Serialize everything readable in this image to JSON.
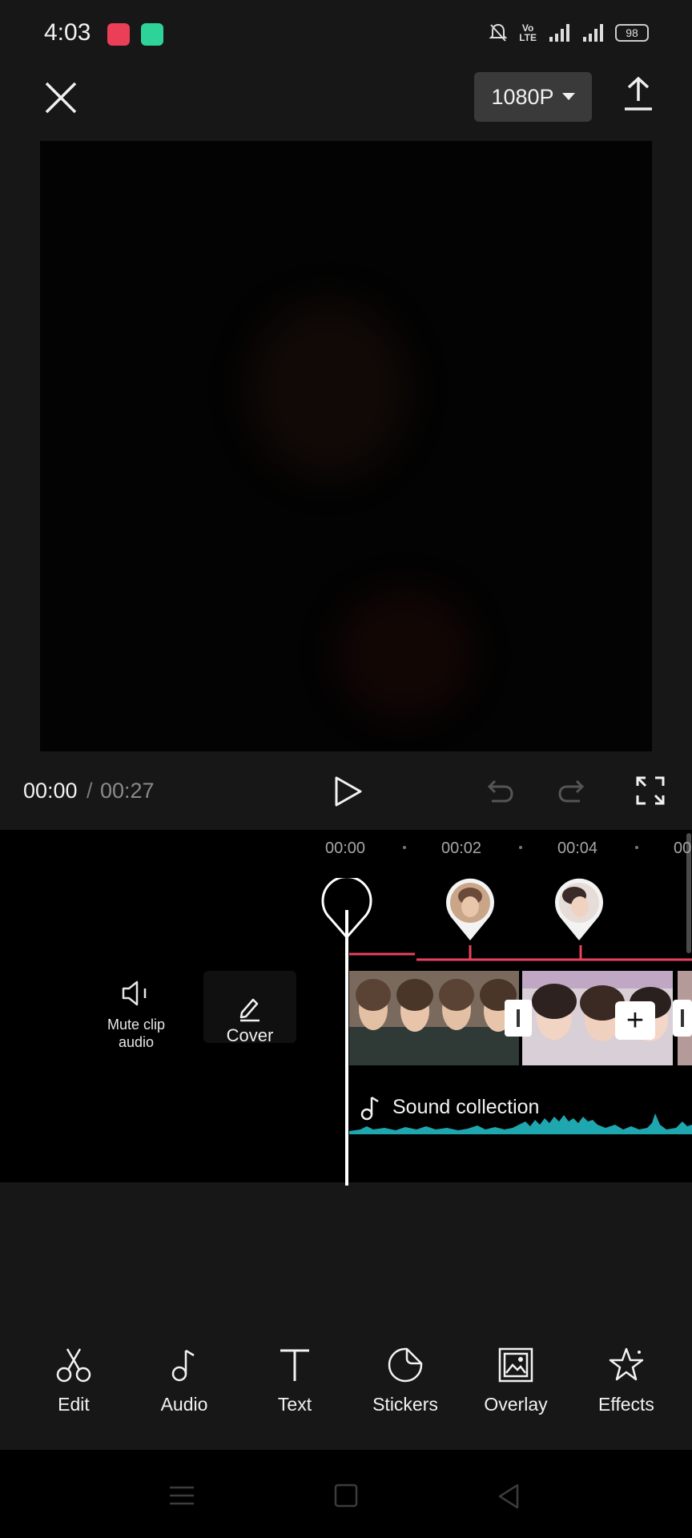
{
  "status_bar": {
    "time": "4:03",
    "volte_top": "Vo",
    "volte_bottom": "LTE",
    "battery": "98"
  },
  "top_bar": {
    "resolution": "1080P"
  },
  "playback": {
    "current_time": "00:00",
    "separator": "/",
    "total_time": "00:27"
  },
  "timeline": {
    "ruler_labels": [
      "00:00",
      "00:02",
      "00:04",
      "00"
    ],
    "mute_label": "Mute clip audio",
    "cover_label": "Cover",
    "audio_track_label": "Sound collection"
  },
  "toolbar": {
    "items": [
      {
        "label": "Edit",
        "icon": "scissors-icon"
      },
      {
        "label": "Audio",
        "icon": "music-note-icon"
      },
      {
        "label": "Text",
        "icon": "text-icon"
      },
      {
        "label": "Stickers",
        "icon": "sticker-icon"
      },
      {
        "label": "Overlay",
        "icon": "overlay-icon"
      },
      {
        "label": "Effects",
        "icon": "effects-star-icon"
      }
    ]
  },
  "colors": {
    "background": "#171717",
    "timeline_background": "#000000",
    "marker_line": "#e8435c",
    "audio_wave": "#1fa7b0",
    "resolution_button": "#3a3a3a"
  }
}
